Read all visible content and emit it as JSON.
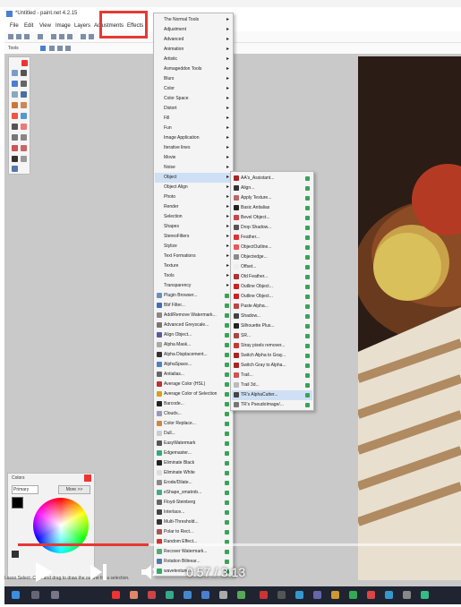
{
  "app": {
    "title": "*Untitled - paint.net 4.2.15",
    "menu": [
      "File",
      "Edit",
      "View",
      "Image",
      "Layers",
      "Adjustments",
      "Effects"
    ],
    "tools_label": "Tools",
    "status": "Lasso Select: Click and drag to draw the outline for a selection."
  },
  "effects_menu": [
    {
      "label": "The Normal Tools",
      "arrow": true
    },
    {
      "label": "Adjustment",
      "arrow": true
    },
    {
      "label": "Advanced",
      "arrow": true
    },
    {
      "label": "Animation",
      "arrow": true
    },
    {
      "label": "Artistic",
      "arrow": true
    },
    {
      "label": "Asmageddon Tools",
      "arrow": true
    },
    {
      "label": "Blurs",
      "arrow": true
    },
    {
      "label": "Color",
      "arrow": true
    },
    {
      "label": "Color Space",
      "arrow": true
    },
    {
      "label": "Distort",
      "arrow": true
    },
    {
      "label": "Fill",
      "arrow": true
    },
    {
      "label": "Fun",
      "arrow": true
    },
    {
      "label": "Image Application",
      "arrow": true
    },
    {
      "label": "Iterative lines",
      "arrow": true
    },
    {
      "label": "Movie",
      "arrow": true
    },
    {
      "label": "Noise",
      "arrow": true
    },
    {
      "label": "Object",
      "arrow": true,
      "selected": true
    },
    {
      "label": "Object Align",
      "arrow": true
    },
    {
      "label": "Photo",
      "arrow": true
    },
    {
      "label": "Render",
      "arrow": true
    },
    {
      "label": "Selection",
      "arrow": true
    },
    {
      "label": "Shapes",
      "arrow": true
    },
    {
      "label": "StereoFilters",
      "arrow": true
    },
    {
      "label": "Stylize",
      "arrow": true
    },
    {
      "label": "Text Formations",
      "arrow": true
    },
    {
      "label": "Texture",
      "arrow": true
    },
    {
      "label": "Tools",
      "arrow": true
    },
    {
      "label": "Transparency",
      "arrow": true
    },
    {
      "label": "Plugin Browser...",
      "icon": "#6a8fbf",
      "plugin": true
    },
    {
      "label": "Bbf Filter...",
      "icon": "#3d6fb6",
      "plugin": true
    },
    {
      "label": "Add/Remove Watermark...",
      "icon": "#888",
      "plugin": true
    },
    {
      "label": "Advanced Greyscale...",
      "icon": "#777",
      "plugin": true
    },
    {
      "label": "Align Object...",
      "icon": "#5a5aa0",
      "plugin": true
    },
    {
      "label": "Alpha Mask...",
      "icon": "#aaa",
      "plugin": true
    },
    {
      "label": "Alpha Displacement...",
      "icon": "#333",
      "plugin": true
    },
    {
      "label": "AlphaSpace...",
      "icon": "#5080c0",
      "plugin": true
    },
    {
      "label": "Antialias...",
      "icon": "#666",
      "plugin": true
    },
    {
      "label": "Average Color (HSL)",
      "icon": "#b33",
      "plugin": true
    },
    {
      "label": "Average Color of Selection",
      "icon": "#d8a020",
      "plugin": true
    },
    {
      "label": "Barcode...",
      "icon": "#222",
      "plugin": true
    },
    {
      "label": "Clouds...",
      "icon": "#99b",
      "plugin": true
    },
    {
      "label": "Color Replace...",
      "icon": "#c84",
      "plugin": true
    },
    {
      "label": "Dull...",
      "icon": "#ccc",
      "plugin": true
    },
    {
      "label": "EasyWatermark",
      "icon": "#555",
      "plugin": true
    },
    {
      "label": "Edgemaster...",
      "icon": "#3a7",
      "plugin": true
    },
    {
      "label": "Eliminate Black",
      "icon": "#222",
      "plugin": true
    },
    {
      "label": "Eliminate White",
      "icon": "#ddd",
      "plugin": true
    },
    {
      "label": "Erode/Dilate...",
      "icon": "#888",
      "plugin": true
    },
    {
      "label": "eShape_smatrob...",
      "icon": "#4a8",
      "plugin": true
    },
    {
      "label": "Floyd-Steinberg",
      "icon": "#666",
      "plugin": true
    },
    {
      "label": "Interlace...",
      "icon": "#444",
      "plugin": true
    },
    {
      "label": "Multi-Threshold...",
      "icon": "#333",
      "plugin": true
    },
    {
      "label": "Polar to Rect...",
      "icon": "#a55",
      "plugin": true
    },
    {
      "label": "Random Effect...",
      "icon": "#c33",
      "plugin": true
    },
    {
      "label": "Recover Watermark...",
      "icon": "#5a7",
      "plugin": true
    },
    {
      "label": "Rotation Bilinear...",
      "icon": "#57a",
      "plugin": true
    },
    {
      "label": "wavetexture...",
      "icon": "#3a6",
      "plugin": true
    }
  ],
  "object_submenu": [
    {
      "label": "AA's_Assistant...",
      "icon": "#a22"
    },
    {
      "label": "Align...",
      "icon": "#333"
    },
    {
      "label": "Apply Texture...",
      "icon": "#b66"
    },
    {
      "label": "Basic Antialias",
      "icon": "#222"
    },
    {
      "label": "Bevel Object...",
      "icon": "#c44"
    },
    {
      "label": "Drop Shadow...",
      "icon": "#555"
    },
    {
      "label": "Feather...",
      "icon": "#d33"
    },
    {
      "label": "ObjectOutline...",
      "icon": "#e55"
    },
    {
      "label": "Objectedge...",
      "icon": "#8a8a8a"
    },
    {
      "label": "Offset...",
      "icon": "#eee"
    },
    {
      "label": "Old Feather...",
      "icon": "#a33"
    },
    {
      "label": "Outline Object...",
      "icon": "#c22"
    },
    {
      "label": "Outline Object...",
      "icon": "#c22"
    },
    {
      "label": "Paste Alpha...",
      "icon": "#b44"
    },
    {
      "label": "Shadow...",
      "icon": "#444"
    },
    {
      "label": "Silhouette Plus...",
      "icon": "#222"
    },
    {
      "label": "SR...",
      "icon": "#a44"
    },
    {
      "label": "Stray pixels remover...",
      "icon": "#c33"
    },
    {
      "label": "Switch Alpha to Gray...",
      "icon": "#a22"
    },
    {
      "label": "Switch Gray to Alpha...",
      "icon": "#a22"
    },
    {
      "label": "Trail...",
      "icon": "#c55"
    },
    {
      "label": "Trail 3d...",
      "icon": "#bbb"
    },
    {
      "label": "TR's AlphaCutter...",
      "icon": "#444",
      "selected": true
    },
    {
      "label": "TR's PseudoImage/...",
      "icon": "#777"
    }
  ],
  "colors_panel": {
    "title": "Colors",
    "mode": "Primary",
    "more_label": "More >>",
    "primary_color": "#000000",
    "secondary_color": "#ffffff"
  },
  "video": {
    "time": "0:57 / 3:13",
    "progress_fraction": 0.295
  },
  "colors": {
    "highlight": "#e53935",
    "menu_bg": "#f4f4f4",
    "progress": "#e53935"
  }
}
